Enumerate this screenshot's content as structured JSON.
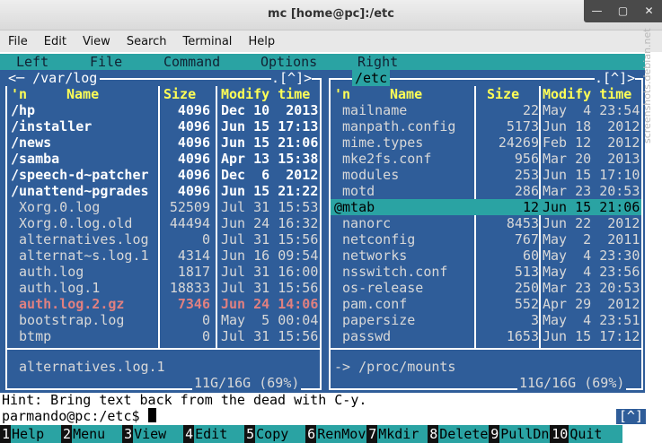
{
  "window": {
    "title": "mc [home@pc]:/etc",
    "controls": [
      "—",
      "▢",
      "✕"
    ]
  },
  "menubar": [
    "File",
    "Edit",
    "View",
    "Search",
    "Terminal",
    "Help"
  ],
  "mc_menu": [
    "Left",
    "File",
    "Command",
    "Options",
    "Right"
  ],
  "left_panel": {
    "path": "<─ /var/log",
    "corner": ".[^]>",
    "headers": {
      "n": "'n",
      "name": "Name",
      "size": "Size",
      "modify": "Modify time"
    },
    "files": [
      {
        "name": "/hp",
        "size": "4096",
        "date": "Dec 10  2013",
        "type": "dir"
      },
      {
        "name": "/installer",
        "size": "4096",
        "date": "Jun 15 17:13",
        "type": "dir"
      },
      {
        "name": "/news",
        "size": "4096",
        "date": "Jun 15 21:06",
        "type": "dir"
      },
      {
        "name": "/samba",
        "size": "4096",
        "date": "Apr 13 15:38",
        "type": "dir"
      },
      {
        "name": "/speech-d~patcher",
        "size": "4096",
        "date": "Dec  6  2012",
        "type": "dir"
      },
      {
        "name": "/unattend~pgrades",
        "size": "4096",
        "date": "Jun 15 21:22",
        "type": "dir"
      },
      {
        "name": " Xorg.0.log",
        "size": "52509",
        "date": "Jul 31 15:53",
        "type": "file"
      },
      {
        "name": " Xorg.0.log.old",
        "size": "44494",
        "date": "Jun 24 16:32",
        "type": "file"
      },
      {
        "name": " alternatives.log",
        "size": "0",
        "date": "Jul 31 15:56",
        "type": "file"
      },
      {
        "name": " alternat~s.log.1",
        "size": "4314",
        "date": "Jun 16 09:54",
        "type": "file"
      },
      {
        "name": " auth.log",
        "size": "1817",
        "date": "Jul 31 16:00",
        "type": "file"
      },
      {
        "name": " auth.log.1",
        "size": "18833",
        "date": "Jul 31 15:56",
        "type": "file"
      },
      {
        "name": " auth.log.2.gz",
        "size": "7346",
        "date": "Jun 24 14:06",
        "type": "core"
      },
      {
        "name": " bootstrap.log",
        "size": "0",
        "date": "May  5 00:04",
        "type": "file"
      },
      {
        "name": " btmp",
        "size": "0",
        "date": "Jul 31 15:56",
        "type": "file"
      }
    ],
    "mini_status": " alternatives.log.1",
    "usage": "11G/16G (69%)"
  },
  "right_panel": {
    "path": "/etc",
    "corner": ".[^]>",
    "headers": {
      "n": "'n",
      "name": "Name",
      "size": "Size",
      "modify": "Modify time"
    },
    "files": [
      {
        "name": " mailname",
        "size": "22",
        "date": "May  4 23:54",
        "type": "file"
      },
      {
        "name": " manpath.config",
        "size": "5173",
        "date": "Jun 18  2012",
        "type": "file"
      },
      {
        "name": " mime.types",
        "size": "24269",
        "date": "Feb 12  2012",
        "type": "file"
      },
      {
        "name": " mke2fs.conf",
        "size": "956",
        "date": "Mar 20  2013",
        "type": "file"
      },
      {
        "name": " modules",
        "size": "253",
        "date": "Jun 15 17:10",
        "type": "file"
      },
      {
        "name": " motd",
        "size": "286",
        "date": "Mar 23 20:53",
        "type": "file"
      },
      {
        "name": "@mtab",
        "size": "12",
        "date": "Jun 15 21:06",
        "type": "sel"
      },
      {
        "name": " nanorc",
        "size": "8453",
        "date": "Jun 22  2012",
        "type": "file"
      },
      {
        "name": " netconfig",
        "size": "767",
        "date": "May  2  2011",
        "type": "file"
      },
      {
        "name": " networks",
        "size": "60",
        "date": "May  4 23:30",
        "type": "file"
      },
      {
        "name": " nsswitch.conf",
        "size": "513",
        "date": "May  4 23:56",
        "type": "file"
      },
      {
        "name": " os-release",
        "size": "250",
        "date": "Mar 23 20:53",
        "type": "file"
      },
      {
        "name": " pam.conf",
        "size": "552",
        "date": "Apr 29  2012",
        "type": "file"
      },
      {
        "name": " papersize",
        "size": "3",
        "date": "May  4 23:51",
        "type": "file"
      },
      {
        "name": " passwd",
        "size": "1653",
        "date": "Jun 15 17:12",
        "type": "file"
      }
    ],
    "mini_status": "-> /proc/mounts",
    "usage": "11G/16G (69%)"
  },
  "hint": "Hint: Bring text back from the dead with C-y.",
  "prompt": "parmando@pc:/etc$ ",
  "scroll_marker": "[^]",
  "fkeys": [
    {
      "n": "1",
      "label": "Help"
    },
    {
      "n": "2",
      "label": "Menu"
    },
    {
      "n": "3",
      "label": "View"
    },
    {
      "n": "4",
      "label": "Edit"
    },
    {
      "n": "5",
      "label": "Copy"
    },
    {
      "n": "6",
      "label": "RenMov"
    },
    {
      "n": "7",
      "label": "Mkdir"
    },
    {
      "n": "8",
      "label": "Delete"
    },
    {
      "n": "9",
      "label": "PullDn"
    },
    {
      "n": "10",
      "label": "Quit"
    }
  ],
  "watermark": "screenshots.debian.net"
}
